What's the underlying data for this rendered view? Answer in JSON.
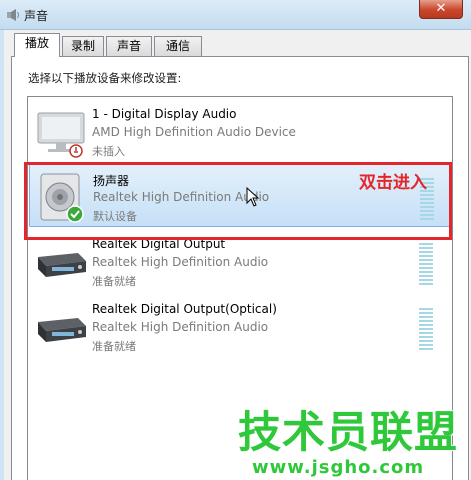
{
  "window": {
    "title": "声音",
    "close_label": "✕"
  },
  "tabs": [
    {
      "label": "播放",
      "active": true
    },
    {
      "label": "录制",
      "active": false
    },
    {
      "label": "声音",
      "active": false
    },
    {
      "label": "通信",
      "active": false
    }
  ],
  "panel": {
    "instruction": "选择以下播放设备来修改设置:"
  },
  "devices": [
    {
      "name": "1 - Digital Display Audio",
      "description": "AMD High Definition Audio Device",
      "status": "未插入",
      "icon": "monitor-icon",
      "selected": false
    },
    {
      "name": "扬声器",
      "description": "Realtek High Definition Audio",
      "status": "默认设备",
      "icon": "speaker-icon",
      "selected": true
    },
    {
      "name": "Realtek Digital Output",
      "description": "Realtek High Definition Audio",
      "status": "准备就绪",
      "icon": "digital-output-icon",
      "selected": false
    },
    {
      "name": "Realtek Digital Output(Optical)",
      "description": "Realtek High Definition Audio",
      "status": "准备就绪",
      "icon": "digital-output-icon",
      "selected": false
    }
  ],
  "annotation": {
    "text": "双击进入",
    "color": "#e4252b"
  },
  "watermark": {
    "text": "技术员联盟",
    "url": "www.jsgho.com",
    "color": "#2fc83a"
  }
}
